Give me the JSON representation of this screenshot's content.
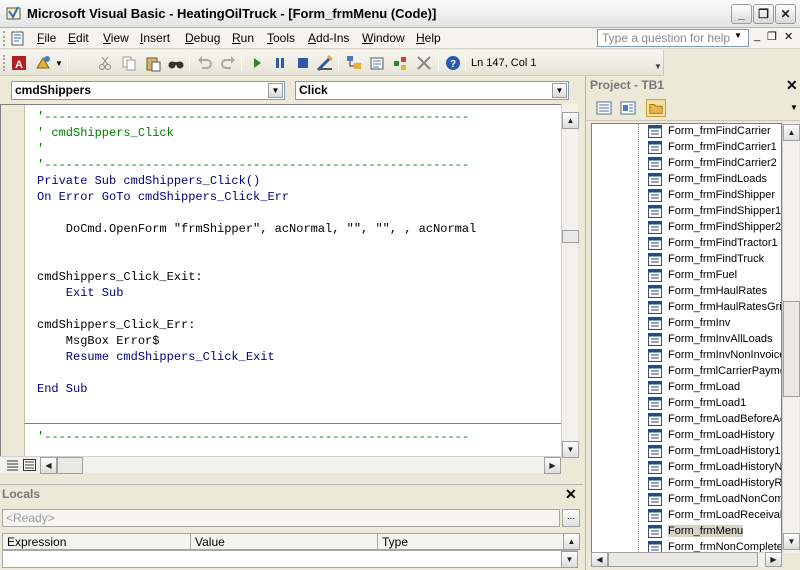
{
  "window": {
    "title": "Microsoft Visual Basic - HeatingOilTruck - [Form_frmMenu (Code)]",
    "minimize": "_",
    "restore": "❐",
    "close": "✕"
  },
  "menubar": {
    "items": [
      "File",
      "Edit",
      "View",
      "Insert",
      "Debug",
      "Run",
      "Tools",
      "Add-Ins",
      "Window",
      "Help"
    ],
    "help_placeholder": "Type a question for help",
    "mdi_min": "_",
    "mdi_restore": "❐",
    "mdi_close": "✕"
  },
  "toolbar": {
    "cursor_position": "Ln 147, Col 1"
  },
  "code_window": {
    "object_combo": "cmdShippers",
    "procedure_combo": "Click",
    "lines": [
      {
        "text": "'-----------------------------------------------------------",
        "kind": "comment"
      },
      {
        "text": "' cmdShippers_Click",
        "kind": "comment"
      },
      {
        "text": "'",
        "kind": "comment"
      },
      {
        "text": "'-----------------------------------------------------------",
        "kind": "comment"
      },
      {
        "text": "Private Sub cmdShippers_Click()",
        "kind": "normal"
      },
      {
        "text": "On Error GoTo cmdShippers_Click_Err",
        "kind": "normal"
      },
      {
        "text": "",
        "kind": "normal"
      },
      {
        "text": "    DoCmd.OpenForm \"frmShipper\", acNormal, \"\", \"\", , acNormal",
        "kind": "black"
      },
      {
        "text": "",
        "kind": "normal"
      },
      {
        "text": "",
        "kind": "normal"
      },
      {
        "text": "cmdShippers_Click_Exit:",
        "kind": "black"
      },
      {
        "text": "    Exit Sub",
        "kind": "normal"
      },
      {
        "text": "",
        "kind": "normal"
      },
      {
        "text": "cmdShippers_Click_Err:",
        "kind": "black"
      },
      {
        "text": "    MsgBox Error$",
        "kind": "black"
      },
      {
        "text": "    Resume cmdShippers_Click_Exit",
        "kind": "normal"
      },
      {
        "text": "",
        "kind": "normal"
      },
      {
        "text": "End Sub",
        "kind": "normal"
      },
      {
        "text": "",
        "kind": "normal"
      },
      {
        "text": "",
        "kind": "normal"
      },
      {
        "text": "'-----------------------------------------------------------",
        "kind": "comment"
      }
    ]
  },
  "locals": {
    "title": "Locals",
    "status": "<Ready>",
    "columns": [
      "Expression",
      "Value",
      "Type"
    ]
  },
  "project": {
    "title": "Project - TB1",
    "items": [
      "Form_frmFindCarrier",
      "Form_frmFindCarrier1",
      "Form_frmFindCarrier2",
      "Form_frmFindLoads",
      "Form_frmFindShipper",
      "Form_frmFindShipper1",
      "Form_frmFindShipper2",
      "Form_frmFindTractor1",
      "Form_frmFindTruck",
      "Form_frmFuel",
      "Form_frmHaulRates",
      "Form_frmHaulRatesGrid",
      "Form_frmInv",
      "Form_frmInvAllLoads",
      "Form_frmInvNonInvoice",
      "Form_frmlCarrierPayme",
      "Form_frmLoad",
      "Form_frmLoad1",
      "Form_frmLoadBeforeAd",
      "Form_frmLoadHistory",
      "Form_frmLoadHistory1",
      "Form_frmLoadHistoryNo",
      "Form_frmLoadHistoryRe",
      "Form_frmLoadNonComp",
      "Form_frmLoadReceivab",
      "Form_frmMenu",
      "Form_frmNonComplete"
    ],
    "selected": "Form_frmMenu"
  }
}
